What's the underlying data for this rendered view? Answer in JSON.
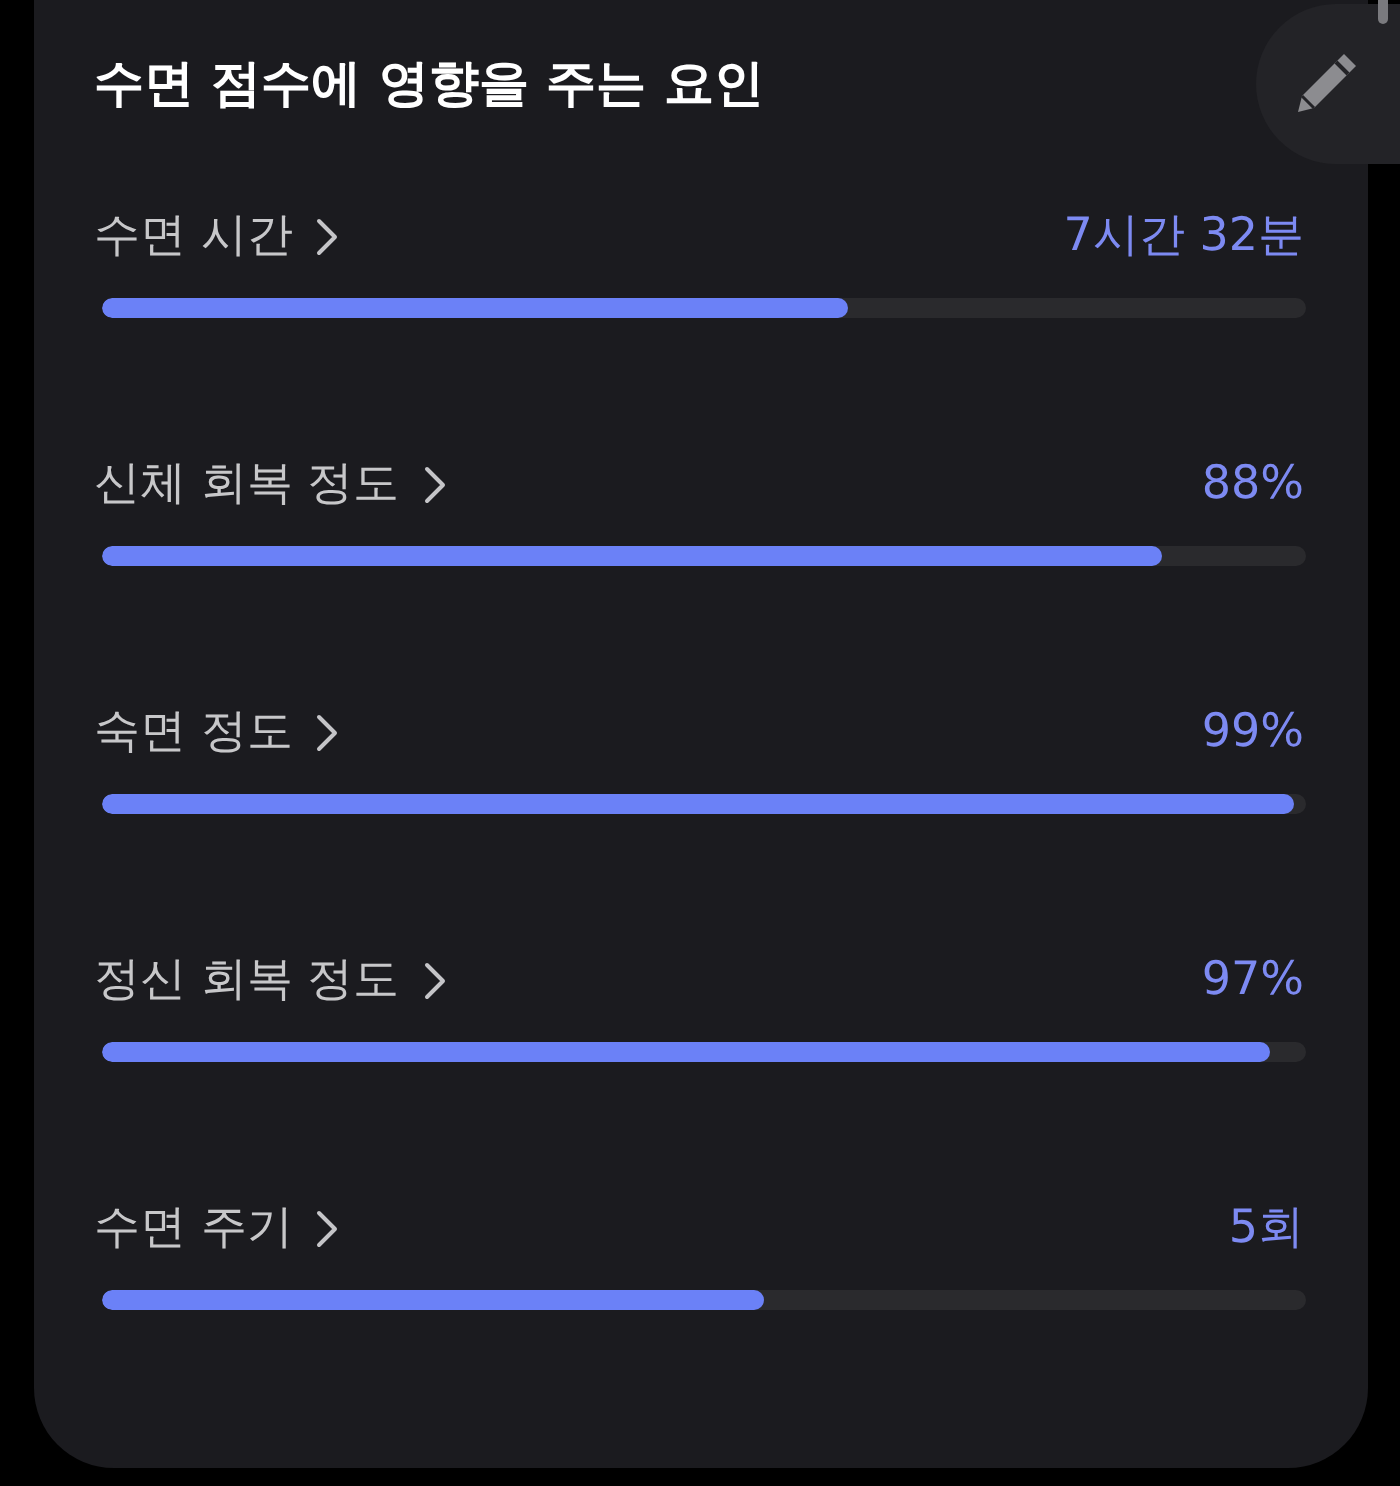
{
  "card": {
    "title": "수면 점수에 영향을 주는 요인"
  },
  "factors": [
    {
      "label": "수면 시간",
      "value": "7시간 32분",
      "level": 0.62
    },
    {
      "label": "신체 회복 정도",
      "value": "88%",
      "level": 0.88
    },
    {
      "label": "숙면 정도",
      "value": "99%",
      "level": 0.99
    },
    {
      "label": "정신 회복 정도",
      "value": "97%",
      "level": 0.97
    },
    {
      "label": "수면 주기",
      "value": "5회",
      "level": 0.55
    }
  ]
}
